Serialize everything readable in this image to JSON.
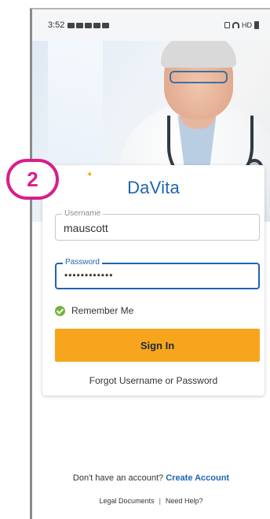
{
  "status_bar": {
    "time": "3:52",
    "network": "HD"
  },
  "brand": {
    "name": "DaVita"
  },
  "login": {
    "username_label": "Username",
    "username_value": "mauscott",
    "password_label": "Password",
    "password_value": "••••••••••••",
    "remember_label": "Remember Me",
    "signin_label": "Sign In",
    "forgot_label": "Forgot Username or Password"
  },
  "footer": {
    "no_account_text": "Don't have an account?",
    "create_account_label": "Create Account",
    "legal_label": "Legal Documents",
    "separator": "|",
    "help_label": "Need Help?"
  },
  "step_badge": {
    "number": "2"
  },
  "colors": {
    "accent": "#1f64b0",
    "button": "#f7a51d",
    "check": "#72b43b",
    "badge": "#d91e8c"
  }
}
